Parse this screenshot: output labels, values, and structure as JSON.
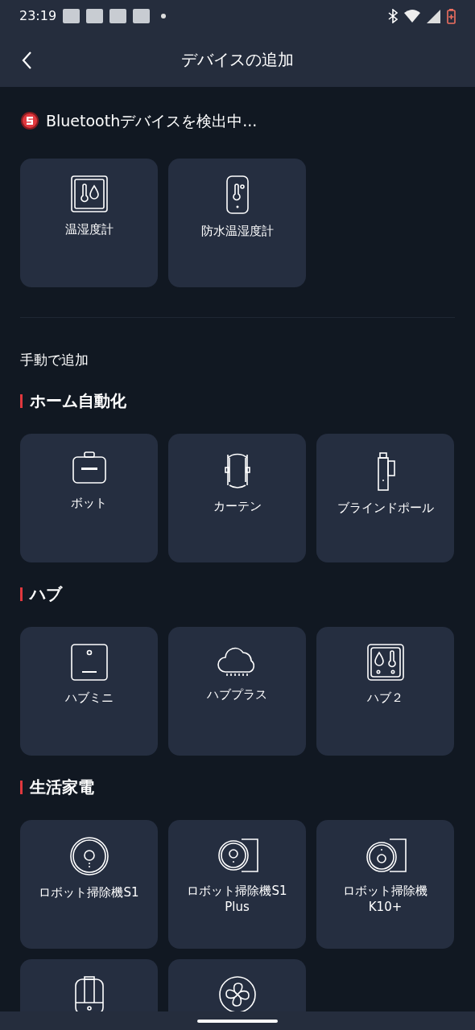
{
  "status_bar": {
    "time": "23:19"
  },
  "header": {
    "title": "デバイスの追加"
  },
  "scanning": {
    "text": "Bluetoothデバイスを検出中..."
  },
  "found_devices": [
    {
      "label": "温湿度計",
      "kind": "meter"
    },
    {
      "label": "防水温湿度計",
      "kind": "outdoor-meter"
    }
  ],
  "manual_title": "手動で追加",
  "categories": [
    {
      "title": "ホーム自動化",
      "devices": [
        {
          "label": "ボット",
          "kind": "bot"
        },
        {
          "label": "カーテン",
          "kind": "curtain"
        },
        {
          "label": "ブラインドポール",
          "kind": "blind"
        }
      ]
    },
    {
      "title": "ハブ",
      "devices": [
        {
          "label": "ハブミニ",
          "kind": "hub-mini"
        },
        {
          "label": "ハブプラス",
          "kind": "cloud"
        },
        {
          "label": "ハブ２",
          "kind": "hub2"
        }
      ]
    },
    {
      "title": "生活家電",
      "devices": [
        {
          "label": "ロボット掃除機S1",
          "kind": "robot"
        },
        {
          "label": "ロボット掃除機S1 Plus",
          "kind": "robot-dock"
        },
        {
          "label": "ロボット掃除機 K10+",
          "kind": "robot-dock2"
        },
        {
          "kind": "humidifier"
        },
        {
          "kind": "fan"
        }
      ]
    }
  ]
}
